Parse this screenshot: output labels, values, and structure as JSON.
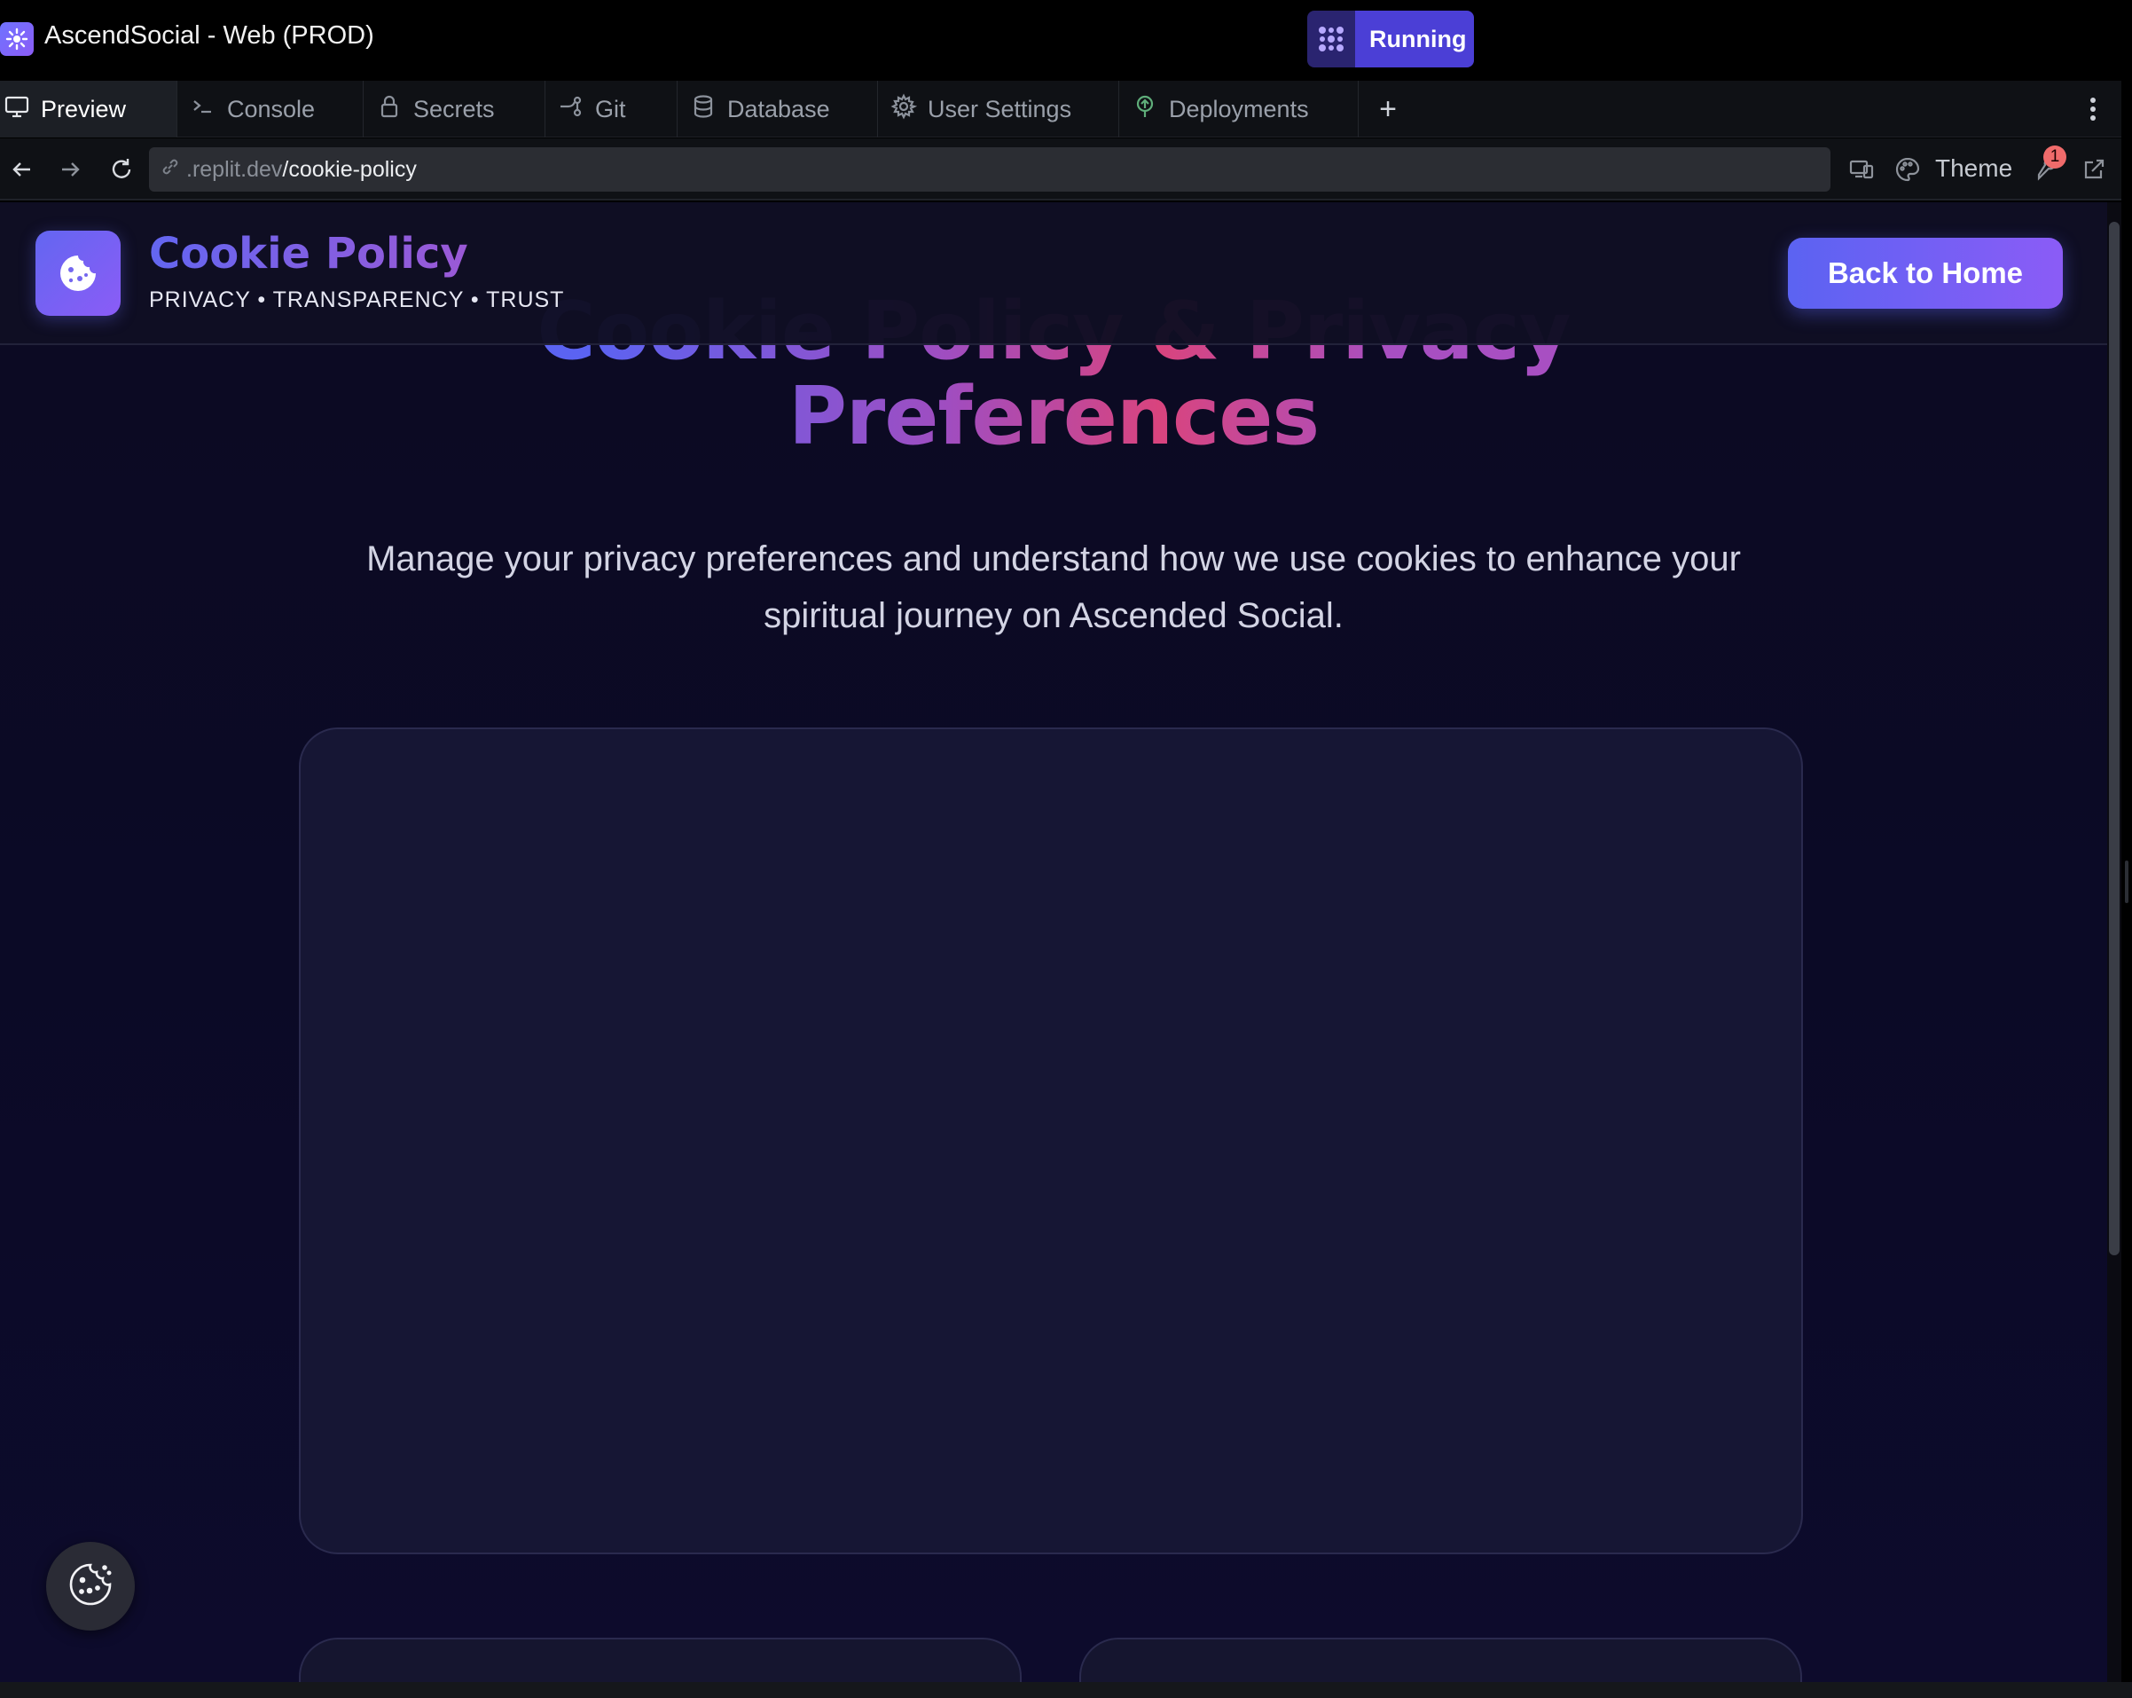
{
  "window": {
    "title": "AscendSocial - Web (PROD)",
    "status_label": "Running"
  },
  "tabs": [
    {
      "label": "Preview",
      "icon": "monitor-icon",
      "active": true
    },
    {
      "label": "Console",
      "icon": "terminal-icon",
      "active": false
    },
    {
      "label": "Secrets",
      "icon": "lock-icon",
      "active": false
    },
    {
      "label": "Git",
      "icon": "git-icon",
      "active": false
    },
    {
      "label": "Database",
      "icon": "database-icon",
      "active": false
    },
    {
      "label": "User Settings",
      "icon": "gear-icon",
      "active": false
    },
    {
      "label": "Deployments",
      "icon": "deploy-icon",
      "active": false
    }
  ],
  "urlbar": {
    "host": ".replit.dev",
    "path": "/cookie-policy",
    "theme_label": "Theme",
    "devtools_badge": "1"
  },
  "page": {
    "header": {
      "title": "Cookie Policy",
      "tagline": "PRIVACY • TRANSPARENCY • TRUST",
      "back_button": "Back to Home"
    },
    "hero": {
      "title_line1": "Cookie Policy & Privacy",
      "title_line2": "Preferences",
      "subtitle": "Manage your privacy preferences and understand how we use cookies to enhance your spiritual journey on Ascended Social."
    }
  },
  "colors": {
    "accent": "#6366f1",
    "accent_secondary": "#8b5cf6",
    "pink": "#d9447e",
    "running_badge": "#4b3fd6",
    "page_bg": "#0c0a22"
  }
}
